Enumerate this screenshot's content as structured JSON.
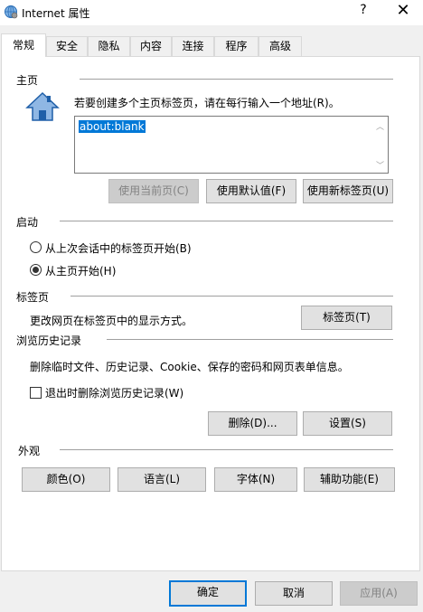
{
  "window": {
    "title": "Internet 属性",
    "help_glyph": "?",
    "close_glyph": "✕"
  },
  "tabs": [
    {
      "label": "常规"
    },
    {
      "label": "安全"
    },
    {
      "label": "隐私"
    },
    {
      "label": "内容"
    },
    {
      "label": "连接"
    },
    {
      "label": "程序"
    },
    {
      "label": "高级"
    }
  ],
  "homepage": {
    "section": "主页",
    "instruction": "若要创建多个主页标签页，请在每行输入一个地址(R)。",
    "url_value": "about:blank",
    "btn_current": "使用当前页(C)",
    "btn_default": "使用默认值(F)",
    "btn_newtab": "使用新标签页(U)"
  },
  "startup": {
    "section": "启动",
    "option_last_session": "从上次会话中的标签页开始(B)",
    "option_homepage": "从主页开始(H)"
  },
  "tabs_section": {
    "section": "标签页",
    "description": "更改网页在标签页中的显示方式。",
    "btn_tabs": "标签页(T)"
  },
  "history": {
    "section": "浏览历史记录",
    "description": "删除临时文件、历史记录、Cookie、保存的密码和网页表单信息。",
    "checkbox_label": "退出时删除浏览历史记录(W)",
    "btn_delete": "删除(D)...",
    "btn_settings": "设置(S)"
  },
  "appearance": {
    "section": "外观",
    "btn_colors": "颜色(O)",
    "btn_languages": "语言(L)",
    "btn_fonts": "字体(N)",
    "btn_accessibility": "辅助功能(E)"
  },
  "footer": {
    "ok": "确定",
    "cancel": "取消",
    "apply": "应用(A)"
  }
}
